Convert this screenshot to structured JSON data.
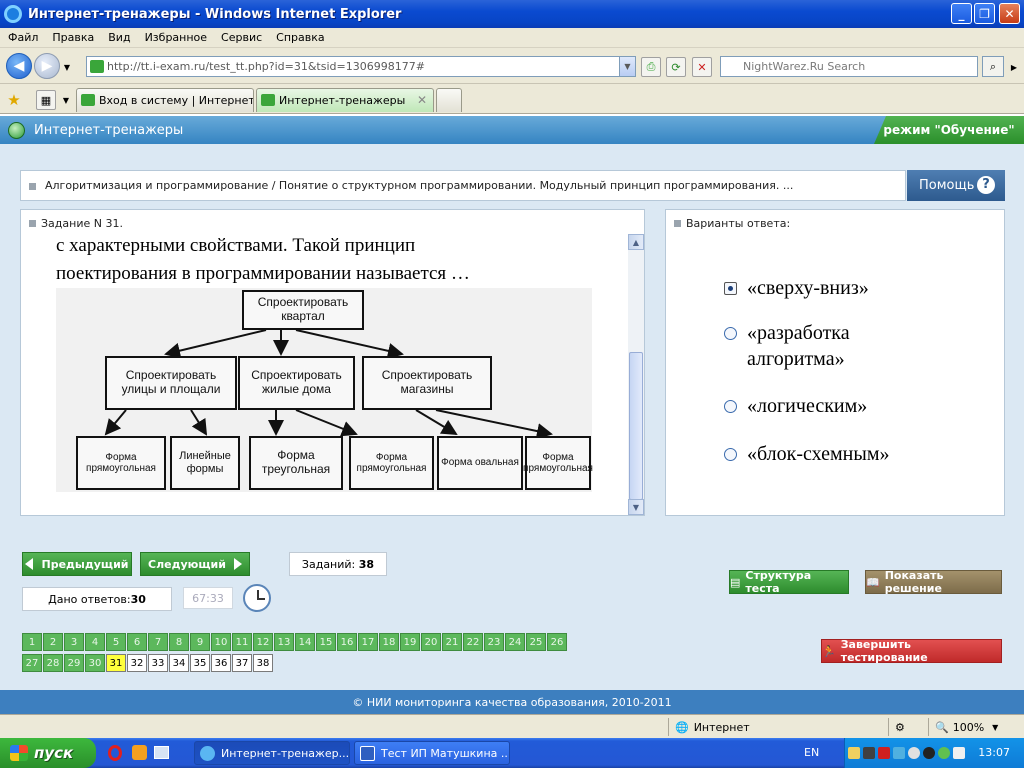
{
  "window": {
    "title": "Интернет-тренажеры - Windows Internet Explorer"
  },
  "menu": [
    "Файл",
    "Правка",
    "Вид",
    "Избранное",
    "Сервис",
    "Справка"
  ],
  "address": {
    "url": "http://tt.i-exam.ru/test_tt.php?id=31&tsid=1306998177#"
  },
  "search": {
    "placeholder": "NightWarez.Ru Search"
  },
  "tabs": [
    {
      "label": "Вход в систему | Интернет-..."
    },
    {
      "label": "Интернет-тренажеры",
      "active": true
    }
  ],
  "app": {
    "title": "Интернет-тренажеры",
    "mode": "режим \"Обучение\""
  },
  "breadcrumb": "Алгоритмизация и программирование / Понятие о структурном программировании. Модульный принцип программирования. ...",
  "help": {
    "label": "Помощь",
    "icon": "?"
  },
  "task": {
    "label": "Задание N 31.",
    "question_lines": [
      "с характерными свойствами. Такой принцип",
      "поектирования в программировании называется …"
    ],
    "diagram": {
      "root": "Спроектировать квартал",
      "level1": [
        "Спроектировать улицы и площали",
        "Спроектировать жилые дома",
        "Спроектировать магазины"
      ],
      "level2": [
        "Форма прямоугольная",
        "Линейные формы",
        "Форма треугольная",
        "Форма прямоугольная",
        "Форма овальная",
        "Форма прямоугольная"
      ]
    }
  },
  "answers": {
    "label": "Варианты ответа:",
    "options": [
      {
        "text": "«сверху-вниз»",
        "selected": true
      },
      {
        "text": "«разработка алгоритма»",
        "selected": false
      },
      {
        "text": "«логическим»",
        "selected": false
      },
      {
        "text": "«блок-схемным»",
        "selected": false
      }
    ]
  },
  "nav": {
    "prev": "Предыдущий",
    "next": "Следующий",
    "count_label": "Заданий:",
    "count_value": "38",
    "answered_label": "Дано ответов:",
    "answered_value": "30",
    "timer": "67:33"
  },
  "questions": {
    "total": 38,
    "current": 31,
    "answered_through": 30
  },
  "actions": {
    "structure": "Структура теста",
    "show_solution": "Показать решение",
    "finish": "Завершить тестирование"
  },
  "footer": "© НИИ мониторинга качества образования, 2010-2011",
  "status": {
    "zone": "Интернет",
    "zoom": "100%"
  },
  "taskbar": {
    "start": "пуск",
    "items": [
      "Интернет-тренажер...",
      "Тест ИП Матушкина ..."
    ],
    "lang": "EN",
    "time": "13:07"
  },
  "colors": {
    "accent_green": "#2d8c2d",
    "header_blue": "#3584c2",
    "current_question": "#ffff3c",
    "finish_red": "#d03030",
    "solution_brown": "#8a7a5a"
  }
}
